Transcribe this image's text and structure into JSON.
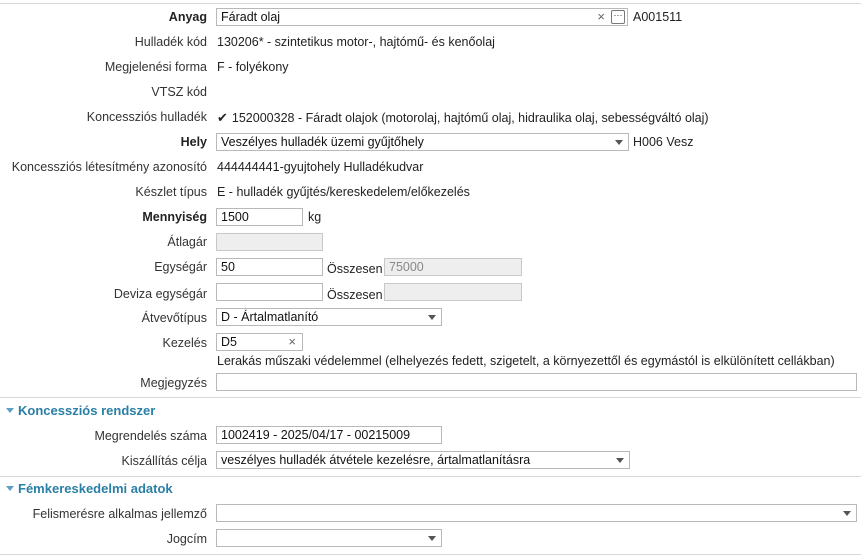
{
  "labels": {
    "anyag": "Anyag",
    "hulladek_kod": "Hulladék kód",
    "megjelenesi_forma": "Megjelenési forma",
    "vtsz_kod": "VTSZ kód",
    "koncesszios_hulladek": "Koncessziós hulladék",
    "hely": "Hely",
    "koncesszios_letesitmeny": "Koncessziós létesítmény azonosító",
    "keszlet_tipus": "Készlet típus",
    "mennyiseg": "Mennyiség",
    "atlagar": "Átlagár",
    "egysegar": "Egységár",
    "deviza_egysegar": "Deviza egységár",
    "atvevotipus": "Átvevőtípus",
    "kezeles": "Kezelés",
    "megjegyzes": "Megjegyzés",
    "osszesen1": "Összesen",
    "osszesen2": "Összesen",
    "megrendeles_szama": "Megrendelés száma",
    "kiszallitas_celja": "Kiszállítás célja",
    "felismeresre": "Felismerésre alkalmas jellemző",
    "jogcim": "Jogcím"
  },
  "values": {
    "anyag": "Fáradt olaj",
    "anyag_code": "A001511",
    "hulladek_kod": "130206* - szintetikus motor-, hajtómű- és kenőolaj",
    "megjelenesi_forma": "F - folyékony",
    "koncesszios_hulladek": "152000328 - Fáradt olajok (motorolaj, hajtómű olaj, hidraulika olaj, sebességváltó olaj)",
    "hely": "Veszélyes hulladék üzemi gyűjtőhely",
    "hely_code": "H006 Vesz",
    "koncesszios_letesitmeny": "444444441-gyujtohely Hulladékudvar",
    "keszlet_tipus": "E - hulladék gyűjtés/kereskedelem/előkezelés",
    "mennyiseg": "1500",
    "mennyiseg_unit": "kg",
    "atlagar": "",
    "egysegar": "50",
    "osszesen1": "75000",
    "deviza_egysegar": "",
    "osszesen2": "",
    "atvevotipus": "D - Ártalmatlanító",
    "kezeles": "D5",
    "kezeles_desc": "Lerakás műszaki védelemmel (elhelyezés fedett, szigetelt, a környezettől és egymástól is elkülönített cellákban)",
    "megjegyzes": "",
    "megrendeles_szama": "1002419 - 2025/04/17 - 00215009",
    "kiszallitas_celja": "veszélyes hulladék átvétele kezelésre, ártalmatlanításra",
    "felismeresre": "",
    "jogcim": ""
  },
  "sections": {
    "koncesszios_rendszer": "Koncessziós rendszer",
    "femkereskedelmi_adatok": "Fémkereskedelmi adatok"
  },
  "icons": {
    "checkmark": "✔",
    "clear": "×",
    "ellipsis": "···"
  },
  "colors": {
    "section_title": "#2a7fa6",
    "field_border": "#b9b9b9",
    "disabled_bg": "#eeeeee"
  }
}
